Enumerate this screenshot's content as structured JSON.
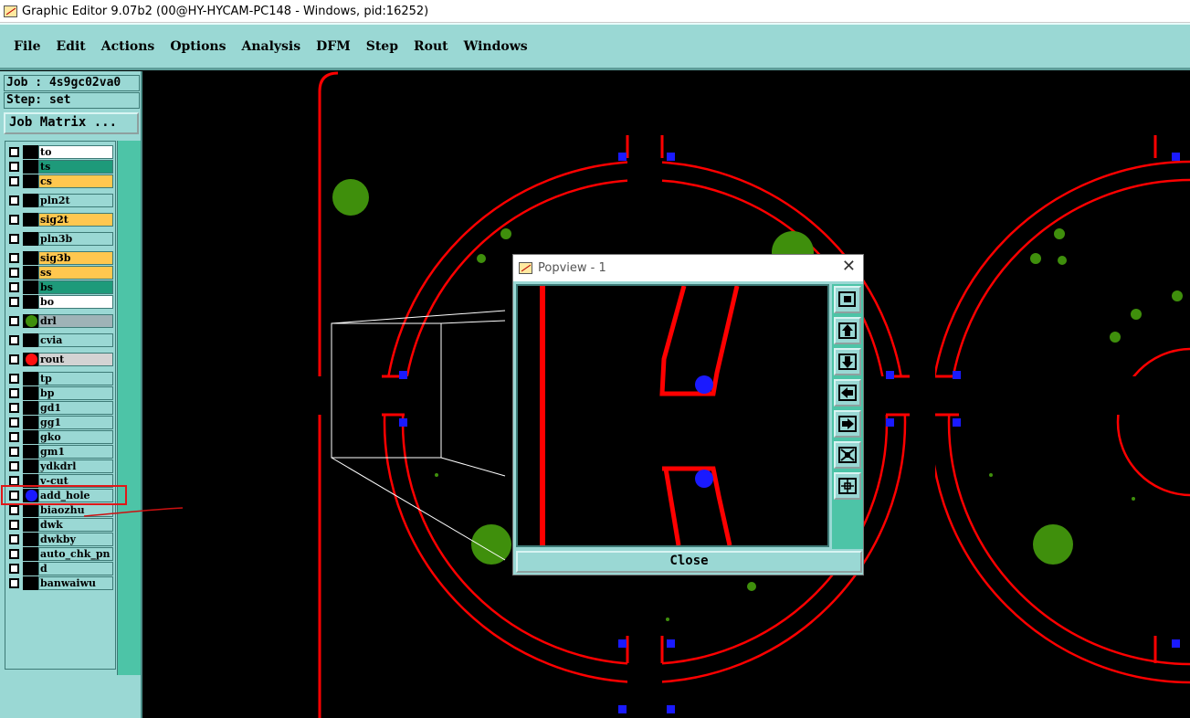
{
  "window": {
    "title": "Graphic Editor 9.07b2 (00@HY-HYCAM-PC148 - Windows, pid:16252)"
  },
  "menu": [
    {
      "label": "File"
    },
    {
      "label": "Edit"
    },
    {
      "label": "Actions"
    },
    {
      "label": "Options"
    },
    {
      "label": "Analysis"
    },
    {
      "label": "DFM"
    },
    {
      "label": "Step"
    },
    {
      "label": "Rout"
    },
    {
      "label": "Windows"
    }
  ],
  "job": {
    "job_label": "Job : 4s9gc02va0",
    "step_label": "Step: set",
    "job_matrix_button": "Job Matrix ..."
  },
  "colors": {
    "teal_panel": "#9ad8d4",
    "dark_teal": "#1e9a7a",
    "orange": "#ffc74f",
    "red_outline": "#ff0000",
    "blue_pad": "#1a1aff",
    "green_pad": "#3f8f0c"
  },
  "layers": [
    {
      "name": "to",
      "bg": "#ffffff",
      "dot": ""
    },
    {
      "name": "ts",
      "bg": "#1e9a7a",
      "dot": ""
    },
    {
      "name": "cs",
      "bg": "#ffc74f",
      "dot": ""
    },
    {
      "name": "pln2t",
      "bg": "#9ad8d4",
      "dot": ""
    },
    {
      "name": "sig2t",
      "bg": "#ffc74f",
      "dot": ""
    },
    {
      "name": "pln3b",
      "bg": "#9ad8d4",
      "dot": ""
    },
    {
      "name": "sig3b",
      "bg": "#ffc74f",
      "dot": ""
    },
    {
      "name": "ss",
      "bg": "#ffc74f",
      "dot": ""
    },
    {
      "name": "bs",
      "bg": "#1e9a7a",
      "dot": ""
    },
    {
      "name": "bo",
      "bg": "#ffffff",
      "dot": ""
    },
    {
      "name": "drl",
      "bg": "#9fb3b7",
      "dot": "#3f8f0c"
    },
    {
      "name": "cvia",
      "bg": "#9ad8d4",
      "dot": ""
    },
    {
      "name": "rout",
      "bg": "#d3d3d3",
      "dot": "#ff1010"
    },
    {
      "name": "tp",
      "bg": "#9ad8d4",
      "dot": ""
    },
    {
      "name": "bp",
      "bg": "#9ad8d4",
      "dot": ""
    },
    {
      "name": "gd1",
      "bg": "#9ad8d4",
      "dot": ""
    },
    {
      "name": "gg1",
      "bg": "#9ad8d4",
      "dot": ""
    },
    {
      "name": "gko",
      "bg": "#9ad8d4",
      "dot": ""
    },
    {
      "name": "gm1",
      "bg": "#9ad8d4",
      "dot": ""
    },
    {
      "name": "ydkdrl",
      "bg": "#9ad8d4",
      "dot": ""
    },
    {
      "name": "v-cut",
      "bg": "#9ad8d4",
      "dot": ""
    },
    {
      "name": "add_hole",
      "bg": "#9ad8d4",
      "dot": "#1a1aff"
    },
    {
      "name": "biaozhu",
      "bg": "#9ad8d4",
      "dot": ""
    },
    {
      "name": "dwk",
      "bg": "#9ad8d4",
      "dot": ""
    },
    {
      "name": "dwkby",
      "bg": "#9ad8d4",
      "dot": ""
    },
    {
      "name": "auto_chk_pn",
      "bg": "#9ad8d4",
      "dot": ""
    },
    {
      "name": "d",
      "bg": "#9ad8d4",
      "dot": ""
    },
    {
      "name": "banwaiwu",
      "bg": "#9ad8d4",
      "dot": ""
    }
  ],
  "popview": {
    "title": "Popview - 1",
    "close_label": "Close",
    "tools": [
      "zoom-fit-icon",
      "pan-up-icon",
      "pan-down-icon",
      "pan-left-icon",
      "pan-right-icon",
      "zoom-out-icon",
      "zoom-in-icon"
    ]
  }
}
